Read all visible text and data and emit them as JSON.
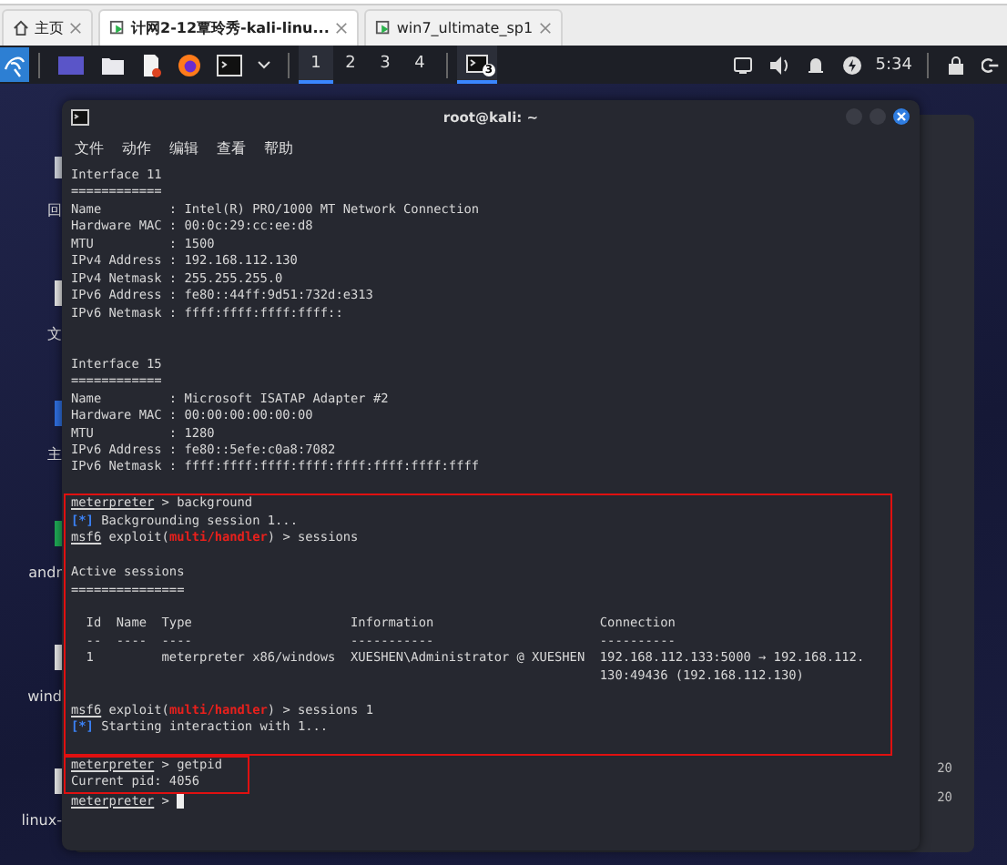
{
  "browser_tabs": [
    {
      "label": "主页",
      "kind": "home",
      "selected": false
    },
    {
      "label": "计网2-12覃玲秀-kali-linu...",
      "kind": "vm",
      "selected": true
    },
    {
      "label": "win7_ultimate_sp1",
      "kind": "vm",
      "selected": false
    }
  ],
  "panel": {
    "workspaces": [
      {
        "label": "1",
        "selected": true
      },
      {
        "label": "2",
        "selected": false
      },
      {
        "label": "3",
        "selected": false
      },
      {
        "label": "4",
        "selected": false
      }
    ],
    "task_badge": "3",
    "clock": "5:34"
  },
  "desktop_icons": [
    {
      "label": "回",
      "kind": "folder"
    },
    {
      "label": "文",
      "kind": "file"
    },
    {
      "label": "主",
      "kind": "home"
    },
    {
      "label": "andr",
      "kind": "android"
    },
    {
      "label": "wind",
      "kind": "file"
    },
    {
      "label": "linux-",
      "kind": "file"
    }
  ],
  "background_window": {
    "lines": [
      "20",
      "20"
    ]
  },
  "terminal": {
    "title": "root@kali: ~",
    "menu": [
      "文件",
      "动作",
      "编辑",
      "查看",
      "帮助"
    ],
    "blocks": [
      {
        "boxed": false,
        "lines": [
          {
            "kind": "text",
            "segments": [
              {
                "text": "Interface 11",
                "kind": "plain"
              }
            ]
          },
          {
            "kind": "text",
            "segments": [
              {
                "text": "============",
                "kind": "plain"
              }
            ]
          },
          {
            "kind": "text",
            "segments": [
              {
                "text": "Name         : Intel(R) PRO/1000 MT Network Connection",
                "kind": "plain"
              }
            ]
          },
          {
            "kind": "text",
            "segments": [
              {
                "text": "Hardware MAC : 00:0c:29:cc:ee:d8",
                "kind": "plain"
              }
            ]
          },
          {
            "kind": "text",
            "segments": [
              {
                "text": "MTU          : 1500",
                "kind": "plain"
              }
            ]
          },
          {
            "kind": "text",
            "segments": [
              {
                "text": "IPv4 Address : 192.168.112.130",
                "kind": "plain"
              }
            ]
          },
          {
            "kind": "text",
            "segments": [
              {
                "text": "IPv4 Netmask : 255.255.255.0",
                "kind": "plain"
              }
            ]
          },
          {
            "kind": "text",
            "segments": [
              {
                "text": "IPv6 Address : fe80::44ff:9d51:732d:e313",
                "kind": "plain"
              }
            ]
          },
          {
            "kind": "text",
            "segments": [
              {
                "text": "IPv6 Netmask : ffff:ffff:ffff:ffff::",
                "kind": "plain"
              }
            ]
          },
          {
            "kind": "blank"
          },
          {
            "kind": "blank"
          },
          {
            "kind": "text",
            "segments": [
              {
                "text": "Interface 15",
                "kind": "plain"
              }
            ]
          },
          {
            "kind": "text",
            "segments": [
              {
                "text": "============",
                "kind": "plain"
              }
            ]
          },
          {
            "kind": "text",
            "segments": [
              {
                "text": "Name         : Microsoft ISATAP Adapter #2",
                "kind": "plain"
              }
            ]
          },
          {
            "kind": "text",
            "segments": [
              {
                "text": "Hardware MAC : 00:00:00:00:00:00",
                "kind": "plain"
              }
            ]
          },
          {
            "kind": "text",
            "segments": [
              {
                "text": "MTU          : 1280",
                "kind": "plain"
              }
            ]
          },
          {
            "kind": "text",
            "segments": [
              {
                "text": "IPv6 Address : fe80::5efe:c0a8:7082",
                "kind": "plain"
              }
            ]
          },
          {
            "kind": "text",
            "segments": [
              {
                "text": "IPv6 Netmask : ffff:ffff:ffff:ffff:ffff:ffff:ffff:ffff",
                "kind": "plain"
              }
            ]
          },
          {
            "kind": "blank"
          }
        ]
      },
      {
        "boxed": true,
        "lines": [
          {
            "kind": "text",
            "segments": [
              {
                "text": "meterpreter",
                "kind": "prompt"
              },
              {
                "text": " > background",
                "kind": "plain"
              }
            ]
          },
          {
            "kind": "text",
            "segments": [
              {
                "text": "[*]",
                "kind": "info"
              },
              {
                "text": " Backgrounding session 1...",
                "kind": "plain"
              }
            ]
          },
          {
            "kind": "text",
            "segments": [
              {
                "text": "msf6",
                "kind": "prompt"
              },
              {
                "text": " exploit(",
                "kind": "plain"
              },
              {
                "text": "multi/handler",
                "kind": "module"
              },
              {
                "text": ") > sessions",
                "kind": "plain"
              }
            ]
          },
          {
            "kind": "blank"
          },
          {
            "kind": "text",
            "segments": [
              {
                "text": "Active sessions",
                "kind": "plain"
              }
            ]
          },
          {
            "kind": "text",
            "segments": [
              {
                "text": "===============",
                "kind": "plain"
              }
            ]
          },
          {
            "kind": "blank"
          },
          {
            "kind": "text",
            "segments": [
              {
                "text": "  Id  Name  Type                     Information                      Connection",
                "kind": "plain"
              }
            ]
          },
          {
            "kind": "text",
            "segments": [
              {
                "text": "  --  ----  ----                     -----------                      ----------",
                "kind": "plain"
              }
            ]
          },
          {
            "kind": "text",
            "segments": [
              {
                "text": "  1         meterpreter x86/windows  XUESHEN\\Administrator @ XUESHEN  192.168.112.133:5000 → 192.168.112.",
                "kind": "plain"
              }
            ]
          },
          {
            "kind": "text",
            "segments": [
              {
                "text": "                                                                      130:49436 (192.168.112.130)",
                "kind": "plain"
              }
            ]
          },
          {
            "kind": "blank"
          },
          {
            "kind": "text",
            "segments": [
              {
                "text": "msf6",
                "kind": "prompt"
              },
              {
                "text": " exploit(",
                "kind": "plain"
              },
              {
                "text": "multi/handler",
                "kind": "module"
              },
              {
                "text": ") > sessions 1",
                "kind": "plain"
              }
            ]
          },
          {
            "kind": "text",
            "segments": [
              {
                "text": "[*]",
                "kind": "info"
              },
              {
                "text": " Starting interaction with 1...",
                "kind": "plain"
              }
            ]
          },
          {
            "kind": "blank"
          }
        ]
      },
      {
        "boxed": true,
        "lines": [
          {
            "kind": "text",
            "segments": [
              {
                "text": "meterpreter",
                "kind": "prompt"
              },
              {
                "text": " > getpid",
                "kind": "plain"
              }
            ]
          },
          {
            "kind": "text",
            "segments": [
              {
                "text": "Current pid: 4056",
                "kind": "plain"
              }
            ]
          }
        ]
      },
      {
        "boxed": false,
        "lines": [
          {
            "kind": "text",
            "cursor": true,
            "segments": [
              {
                "text": "meterpreter",
                "kind": "prompt"
              },
              {
                "text": " > ",
                "kind": "plain"
              }
            ]
          }
        ]
      }
    ]
  }
}
